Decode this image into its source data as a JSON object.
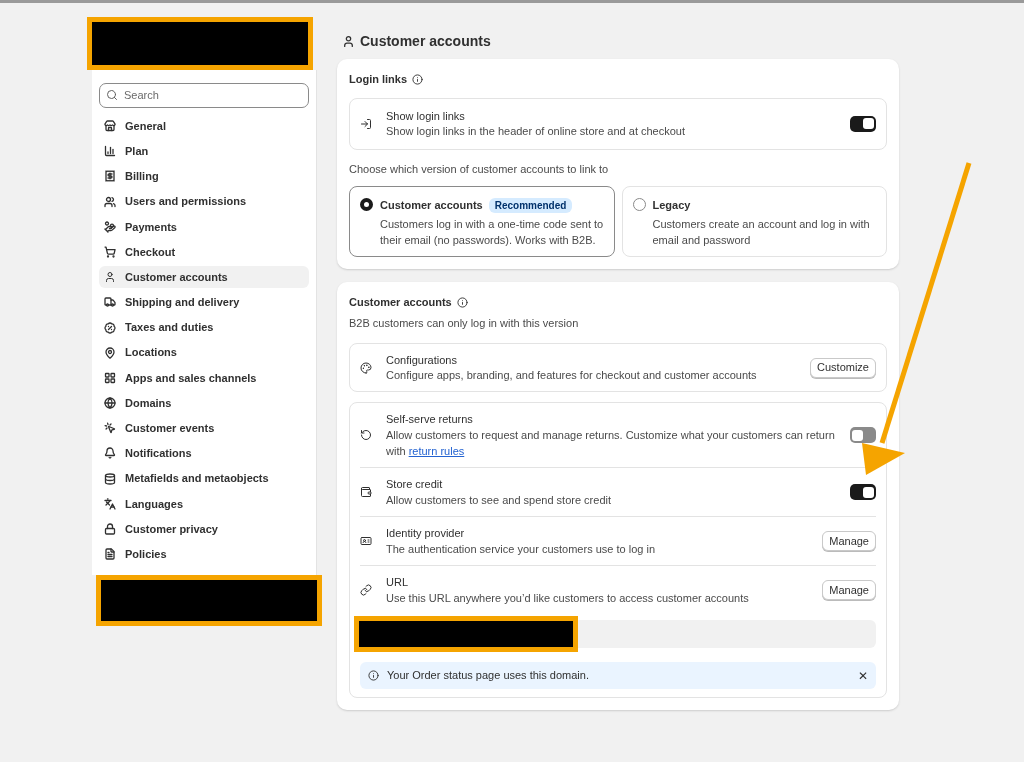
{
  "sidebar": {
    "search": {
      "placeholder": "Search"
    },
    "items": [
      {
        "label": "General",
        "selected": false
      },
      {
        "label": "Plan",
        "selected": false
      },
      {
        "label": "Billing",
        "selected": false
      },
      {
        "label": "Users and permissions",
        "selected": false
      },
      {
        "label": "Payments",
        "selected": false
      },
      {
        "label": "Checkout",
        "selected": false
      },
      {
        "label": "Customer accounts",
        "selected": true
      },
      {
        "label": "Shipping and delivery",
        "selected": false
      },
      {
        "label": "Taxes and duties",
        "selected": false
      },
      {
        "label": "Locations",
        "selected": false
      },
      {
        "label": "Apps and sales channels",
        "selected": false
      },
      {
        "label": "Domains",
        "selected": false
      },
      {
        "label": "Customer events",
        "selected": false
      },
      {
        "label": "Notifications",
        "selected": false
      },
      {
        "label": "Metafields and metaobjects",
        "selected": false
      },
      {
        "label": "Languages",
        "selected": false
      },
      {
        "label": "Customer privacy",
        "selected": false
      },
      {
        "label": "Policies",
        "selected": false
      }
    ]
  },
  "page_title": "Customer accounts",
  "login_links": {
    "title": "Login links",
    "show_login_links": {
      "title": "Show login links",
      "description": "Show login links in the header of online store and at checkout",
      "on": true
    },
    "choose_label": "Choose which version of customer accounts to link to",
    "options": [
      {
        "title": "Customer accounts",
        "badge": "Recommended",
        "description": "Customers log in with a one-time code sent to their email (no passwords). Works with B2B.",
        "selected": true
      },
      {
        "title": "Legacy",
        "description": "Customers create an account and log in with email and password",
        "selected": false
      }
    ]
  },
  "customer_accounts": {
    "title": "Customer accounts",
    "subtitle": "B2B customers can only log in with this version",
    "configurations": {
      "title": "Configurations",
      "description": "Configure apps, branding, and features for checkout and customer accounts",
      "button": "Customize"
    },
    "settings": [
      {
        "kind": "toggle",
        "title": "Self-serve returns",
        "description": "Allow customers to request and manage returns. Customize what your customers can return with",
        "link": "return rules",
        "on": false
      },
      {
        "kind": "toggle",
        "title": "Store credit",
        "description": "Allow customers to see and spend store credit",
        "on": true
      },
      {
        "kind": "button",
        "title": "Identity provider",
        "description": "The authentication service your customers use to log in",
        "button": "Manage"
      },
      {
        "kind": "button",
        "title": "URL",
        "description": "Use this URL anywhere you’d like customers to access customer accounts",
        "button": "Manage"
      }
    ],
    "banner": "Your Order status page uses this domain.",
    "banner_close": "✕"
  }
}
